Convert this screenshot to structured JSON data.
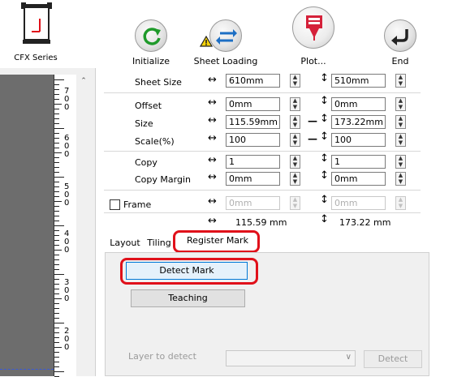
{
  "app": {
    "logo_label": "CFX Series"
  },
  "toolbar": {
    "initialize": "Initialize",
    "sheet_loading": "Sheet Loading",
    "plot": "Plot...",
    "end": "End"
  },
  "ruler": {
    "labels": [
      "700",
      "600",
      "500",
      "400",
      "300",
      "200"
    ]
  },
  "settings": {
    "sheet_size": {
      "label": "Sheet Size",
      "width": "610mm",
      "height": "510mm"
    },
    "offset": {
      "label": "Offset",
      "x": "0mm",
      "y": "0mm"
    },
    "size": {
      "label": "Size",
      "x": "115.59mm",
      "y": "173.22mm"
    },
    "scale": {
      "label": "Scale(%)",
      "x": "100",
      "y": "100"
    },
    "copy": {
      "label": "Copy",
      "x": "1",
      "y": "1"
    },
    "copy_margin": {
      "label": "Copy Margin",
      "x": "0mm",
      "y": "0mm"
    },
    "frame": {
      "label": "Frame",
      "x": "0mm",
      "y": "0mm"
    },
    "total": {
      "x": "115.59 mm",
      "y": "173.22 mm"
    }
  },
  "tabs": {
    "layout": "Layout",
    "tiling": "Tiling",
    "register_mark": "Register Mark"
  },
  "register_mark": {
    "detect_mark": "Detect Mark",
    "teaching": "Teaching",
    "layer_label": "Layer to detect",
    "layer_value": "",
    "detect": "Detect"
  },
  "colors": {
    "highlight": "#e0101a",
    "focus": "#0078d7",
    "plot_accent": "#d5213a"
  }
}
